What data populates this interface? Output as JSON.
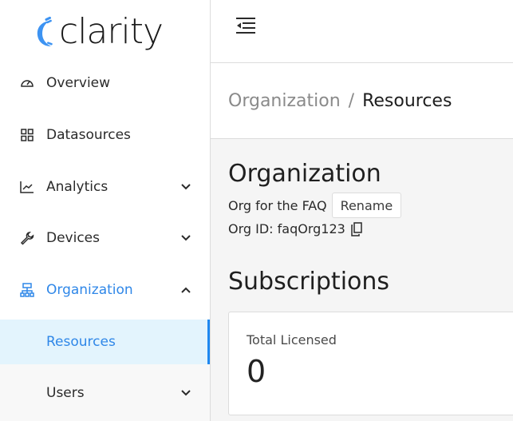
{
  "app": {
    "logo_text": "clarity",
    "brand_color": "#2f87e8"
  },
  "sidebar": {
    "items": [
      {
        "label": "Overview",
        "icon": "dashboard-gauge-icon",
        "expandable": false
      },
      {
        "label": "Datasources",
        "icon": "grid-icon",
        "expandable": false
      },
      {
        "label": "Analytics",
        "icon": "line-chart-icon",
        "expandable": true,
        "expanded": false
      },
      {
        "label": "Devices",
        "icon": "wrench-icon",
        "expandable": true,
        "expanded": false
      },
      {
        "label": "Organization",
        "icon": "org-chart-icon",
        "expandable": true,
        "expanded": true,
        "active": true
      },
      {
        "label": "Resources",
        "sub": true,
        "selected": true
      },
      {
        "label": "Users",
        "sub": true,
        "expandable": true,
        "expanded": false
      }
    ]
  },
  "topbar": {
    "toggle_icon": "collapse-menu-icon"
  },
  "breadcrumb": {
    "parent": "Organization",
    "separator": "/",
    "current": "Resources"
  },
  "main": {
    "org_title": "Organization",
    "org_description": "Org for the FAQ",
    "rename_label": "Rename",
    "org_id_label": "Org ID: faqOrg123",
    "subscriptions_title": "Subscriptions",
    "card": {
      "label": "Total Licensed",
      "value": "0"
    }
  }
}
